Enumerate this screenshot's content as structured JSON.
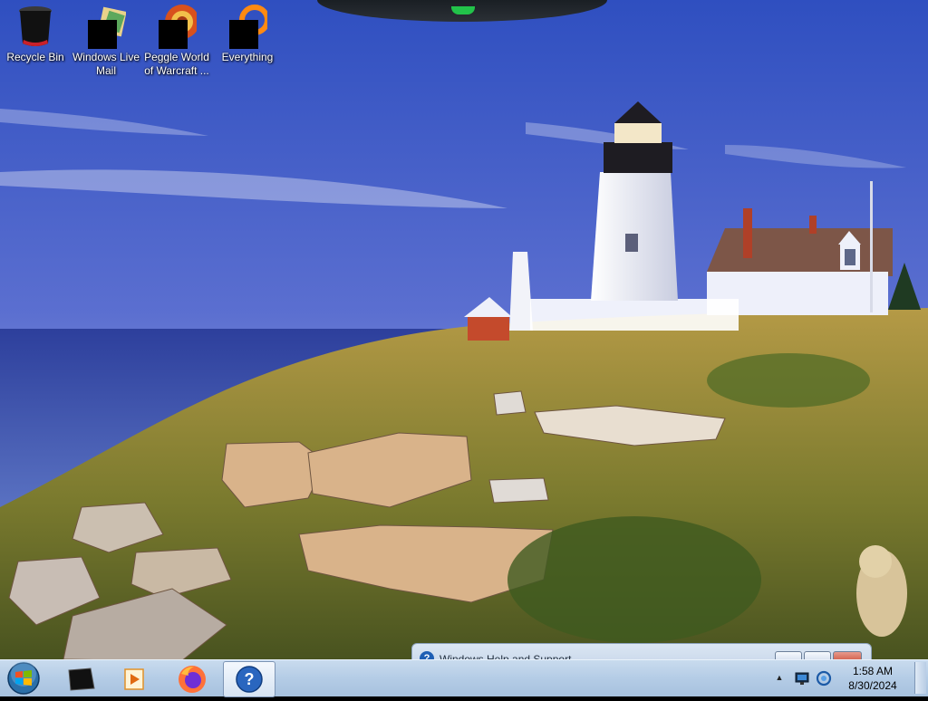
{
  "desktop": {
    "icons": [
      {
        "label_line1": "Recycle Bin",
        "label_line2": "",
        "icon": "recycle-bin-icon"
      },
      {
        "label_line1": "Windows Live",
        "label_line2": "Mail",
        "icon": "windows-live-mail-icon"
      },
      {
        "label_line1": "Peggle World",
        "label_line2": "of Warcraft ...",
        "icon": "peggle-icon"
      },
      {
        "label_line1": "Everything",
        "label_line2": "",
        "icon": "everything-search-icon"
      }
    ]
  },
  "help_window": {
    "title": "Windows Help and Support",
    "icon": "help-icon"
  },
  "taskbar": {
    "start_icon": "windows-start-icon",
    "pinned": [
      {
        "icon": "app-black-icon"
      },
      {
        "icon": "media-player-icon"
      },
      {
        "icon": "firefox-icon"
      },
      {
        "icon": "help-support-icon",
        "active": true
      }
    ],
    "tray": {
      "chevron_icon": "show-hidden-icons-icon",
      "network_icon": "network-icon",
      "sync_icon": "sync-icon",
      "time": "1:58 AM",
      "date": "8/30/2024"
    }
  },
  "colors": {
    "taskbar": "#b4cce6",
    "sky": "#3f5fc8",
    "accent_help": "#1f5fb4"
  }
}
